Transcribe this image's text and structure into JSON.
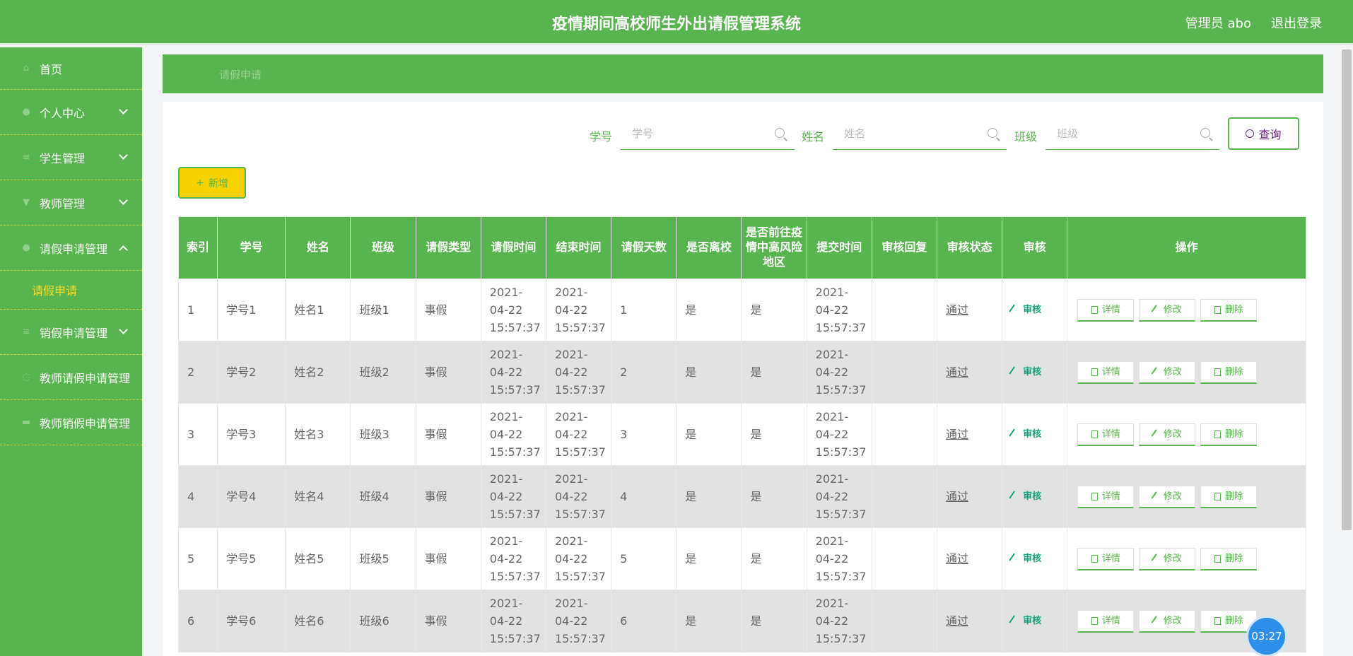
{
  "header": {
    "title": "疫情期间高校师生外出请假管理系统",
    "user": "管理员 abo",
    "logout": "退出登录"
  },
  "sidebar": {
    "items": [
      {
        "label": "首页"
      },
      {
        "label": "个人中心"
      },
      {
        "label": "学生管理"
      },
      {
        "label": "教师管理"
      },
      {
        "label": "请假申请管理"
      },
      {
        "label": "销假申请管理"
      },
      {
        "label": "教师请假申请管理"
      },
      {
        "label": "教师销假申请管理"
      }
    ],
    "sub_item": "请假申请"
  },
  "breadcrumb": "请假申请",
  "search": {
    "student_id_label": "学号",
    "student_id_placeholder": "学号",
    "name_label": "姓名",
    "name_placeholder": "姓名",
    "class_label": "班级",
    "class_placeholder": "班级",
    "query_button": "查询"
  },
  "add_button": "新增",
  "table": {
    "headers": [
      "索引",
      "学号",
      "姓名",
      "班级",
      "请假类型",
      "请假时间",
      "结束时间",
      "请假天数",
      "是否离校",
      "是否前往疫情中高风险地区",
      "提交时间",
      "审核回复",
      "审核状态",
      "审核",
      "操作"
    ],
    "rows": [
      {
        "index": "1",
        "student_id": "学号1",
        "name": "姓名1",
        "class": "班级1",
        "type": "事假",
        "start": "2021-04-22 15:57:37",
        "end": "2021-04-22 15:57:37",
        "days": "1",
        "left_school": "是",
        "risk_area": "是",
        "submitted": "2021-04-22 15:57:37",
        "reply": "",
        "status": "通过"
      },
      {
        "index": "2",
        "student_id": "学号2",
        "name": "姓名2",
        "class": "班级2",
        "type": "事假",
        "start": "2021-04-22 15:57:37",
        "end": "2021-04-22 15:57:37",
        "days": "2",
        "left_school": "是",
        "risk_area": "是",
        "submitted": "2021-04-22 15:57:37",
        "reply": "",
        "status": "通过"
      },
      {
        "index": "3",
        "student_id": "学号3",
        "name": "姓名3",
        "class": "班级3",
        "type": "事假",
        "start": "2021-04-22 15:57:37",
        "end": "2021-04-22 15:57:37",
        "days": "3",
        "left_school": "是",
        "risk_area": "是",
        "submitted": "2021-04-22 15:57:37",
        "reply": "",
        "status": "通过"
      },
      {
        "index": "4",
        "student_id": "学号4",
        "name": "姓名4",
        "class": "班级4",
        "type": "事假",
        "start": "2021-04-22 15:57:37",
        "end": "2021-04-22 15:57:37",
        "days": "4",
        "left_school": "是",
        "risk_area": "是",
        "submitted": "2021-04-22 15:57:37",
        "reply": "",
        "status": "通过"
      },
      {
        "index": "5",
        "student_id": "学号5",
        "name": "姓名5",
        "class": "班级5",
        "type": "事假",
        "start": "2021-04-22 15:57:37",
        "end": "2021-04-22 15:57:37",
        "days": "5",
        "left_school": "是",
        "risk_area": "是",
        "submitted": "2021-04-22 15:57:37",
        "reply": "",
        "status": "通过"
      },
      {
        "index": "6",
        "student_id": "学号6",
        "name": "姓名6",
        "class": "班级6",
        "type": "事假",
        "start": "2021-04-22 15:57:37",
        "end": "2021-04-22 15:57:37",
        "days": "6",
        "left_school": "是",
        "risk_area": "是",
        "submitted": "2021-04-22 15:57:37",
        "reply": "",
        "status": "通过"
      }
    ],
    "audit_label": "审核",
    "ops": {
      "detail": "详情",
      "edit": "修改",
      "delete": "删除"
    }
  },
  "timer": "03:27",
  "colors": {
    "primary": "#58b44e",
    "accent": "#f6d200",
    "link": "#15a37b"
  },
  "icons": {
    "home": "home-icon",
    "user": "user-icon",
    "menu": "menu-icon",
    "search": "search-icon",
    "edit": "edit-icon",
    "document": "document-icon",
    "delete": "trash-icon"
  }
}
